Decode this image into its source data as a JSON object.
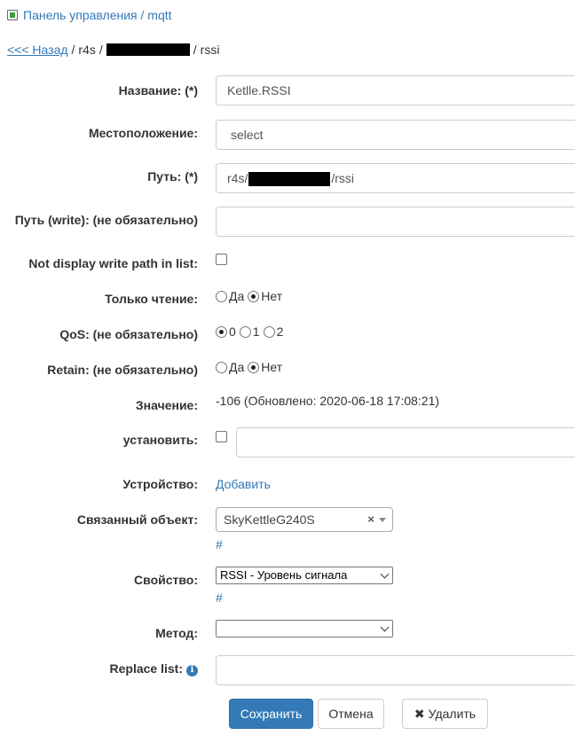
{
  "header": {
    "panel_link": "Панель управления / mqtt"
  },
  "breadcrumb": {
    "back": "<<< Назад",
    "seg1": "r4s",
    "sep": "/",
    "last": "rssi"
  },
  "form": {
    "name": {
      "label": "Название: (*)",
      "value": "Ketlle.RSSI"
    },
    "location": {
      "label": "Местоположение:",
      "value": "select"
    },
    "path": {
      "label": "Путь: (*)",
      "prefix": "r4s/",
      "suffix": "/rssi"
    },
    "path_write": {
      "label": "Путь (write): (не обязательно)",
      "value": ""
    },
    "not_display": {
      "label": "Not display write path in list:"
    },
    "readonly": {
      "label": "Только чтение:",
      "opt_yes": "Да",
      "opt_no": "Нет",
      "selected": "Нет"
    },
    "qos": {
      "label": "QoS: (не обязательно)",
      "opts": [
        "0",
        "1",
        "2"
      ],
      "selected": "0"
    },
    "retain": {
      "label": "Retain: (не обязательно)",
      "opt_yes": "Да",
      "opt_no": "Нет",
      "selected": "Нет"
    },
    "value": {
      "label": "Значение:",
      "text": "-106 (Обновлено: 2020-06-18 17:08:21)"
    },
    "set": {
      "label": "установить:",
      "value": ""
    },
    "device": {
      "label": "Устройство:",
      "link": "Добавить"
    },
    "linked_object": {
      "label": "Связанный объект:",
      "value": "SkyKettleG240S",
      "clear": "×",
      "hash": "#"
    },
    "property": {
      "label": "Свойство:",
      "value": "RSSI - Уровень сигнала",
      "hash": "#"
    },
    "method": {
      "label": "Метод:",
      "value": ""
    },
    "replace_list": {
      "label": "Replace list:",
      "info": "i",
      "value": ""
    }
  },
  "buttons": {
    "save": "Сохранить",
    "cancel": "Отмена",
    "delete": "Удалить",
    "delete_icon": "✖"
  }
}
